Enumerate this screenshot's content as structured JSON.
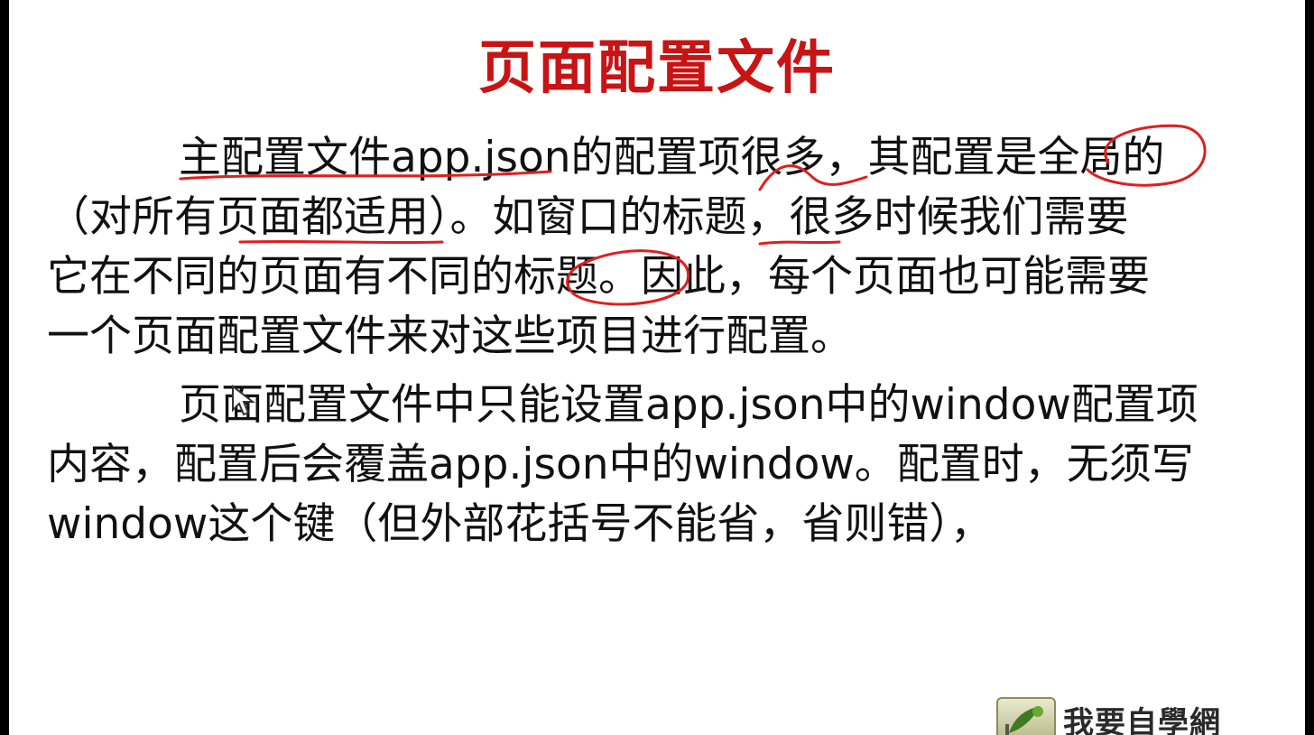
{
  "slide": {
    "title": "页面配置文件",
    "paragraph_1": [
      "主配置文件app.json的配置项很多，其配置是全局的",
      "（对所有页面都适用）。如窗口的标题，很多时候我们需要",
      "它在不同的页面有不同的标题。因此，每个页面也可能需要",
      "一个页面配置文件来对这些项目进行配置。"
    ],
    "paragraph_2": [
      "页面配置文件中只能设置app.json中的window配置项",
      "内容，配置后会覆盖app.json中的window。配置时，无须写",
      "window这个键（但外部花括号不能省，省则错），"
    ]
  },
  "logo": {
    "text": "我要自學網"
  },
  "colors": {
    "title": "#c81414",
    "annotation": "#e01e1e",
    "text": "#111111"
  }
}
